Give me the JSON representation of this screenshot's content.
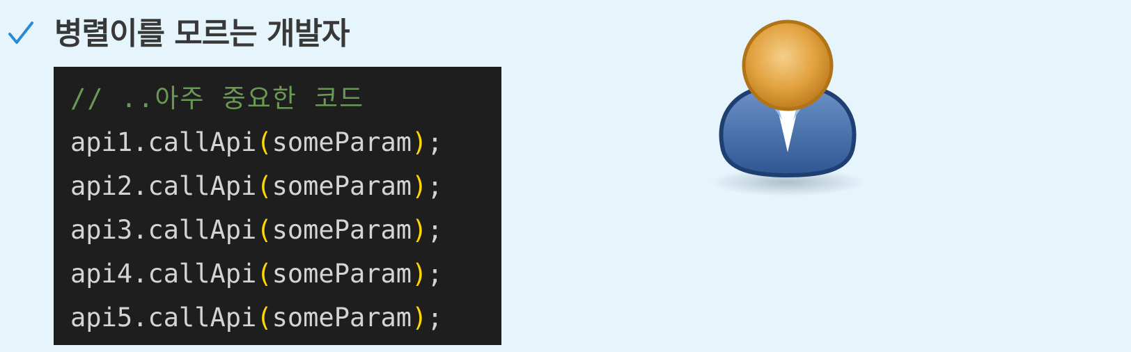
{
  "slide": {
    "bullet_icon": "check-icon",
    "heading": "병렬이를 모르는 개발자",
    "avatar_icon": "user-avatar-icon"
  },
  "code": {
    "comment": "// ..아주 중요한 코드",
    "lines": [
      {
        "call": "api1.callApi",
        "open": "(",
        "arg": "someParam",
        "close": ")",
        "end": ";"
      },
      {
        "call": "api2.callApi",
        "open": "(",
        "arg": "someParam",
        "close": ")",
        "end": ";"
      },
      {
        "call": "api3.callApi",
        "open": "(",
        "arg": "someParam",
        "close": ")",
        "end": ";"
      },
      {
        "call": "api4.callApi",
        "open": "(",
        "arg": "someParam",
        "close": ")",
        "end": ";"
      },
      {
        "call": "api5.callApi",
        "open": "(",
        "arg": "someParam",
        "close": ")",
        "end": ";"
      }
    ]
  },
  "colors": {
    "background": "#e6f4fc",
    "check": "#2a8ad2",
    "code_bg": "#1e1e1e",
    "comment": "#6a9955",
    "paren": "#ffd700",
    "shirt": "#3b66a5",
    "head": "#e2a240"
  }
}
